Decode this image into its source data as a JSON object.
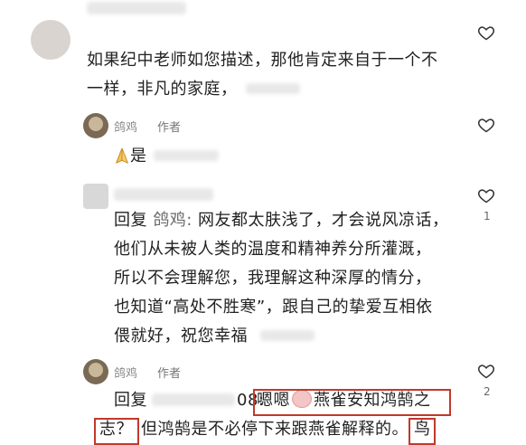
{
  "comment1": {
    "text_line1": "如果纪中老师如您描述，那他肯定来自于一个不",
    "text_line2": "一样，非凡的家庭，"
  },
  "reply1": {
    "username": "鸽鸡",
    "author_tag": "作者",
    "text": "是"
  },
  "comment2": {
    "like_count": "1",
    "reply_prefix": "回复",
    "mention": "鸽鸡:",
    "line1": "网友都太肤浅了，才会说风凉话，",
    "line2": "他们从未被人类的温度和精神养分所灌溉，",
    "line3": "所以不会理解您，我理解这种深厚的情分，",
    "line4": "也知道“高处不胜寒”，跟自己的挚爱互相依",
    "line5": "偎就好，祝您幸福"
  },
  "reply2": {
    "username": "鸽鸡",
    "author_tag": "作者",
    "like_count": "2",
    "reply_prefix": "回复",
    "time_fragment": "08:",
    "boxed1": "嗯嗯",
    "boxed1_rest": "燕雀安知鸿鹄之",
    "boxed2": "志？",
    "middle": "但鸿鹄是不必停下来跟燕雀解释的。",
    "boxed3": "鸟"
  },
  "icons": {
    "heart": "heart-outline-icon",
    "pray": "praying-hands-icon",
    "emoji": "blushing-face-emoji-icon"
  },
  "colors": {
    "highlight_border": "#c0392b",
    "heart_stroke": "#333333"
  }
}
